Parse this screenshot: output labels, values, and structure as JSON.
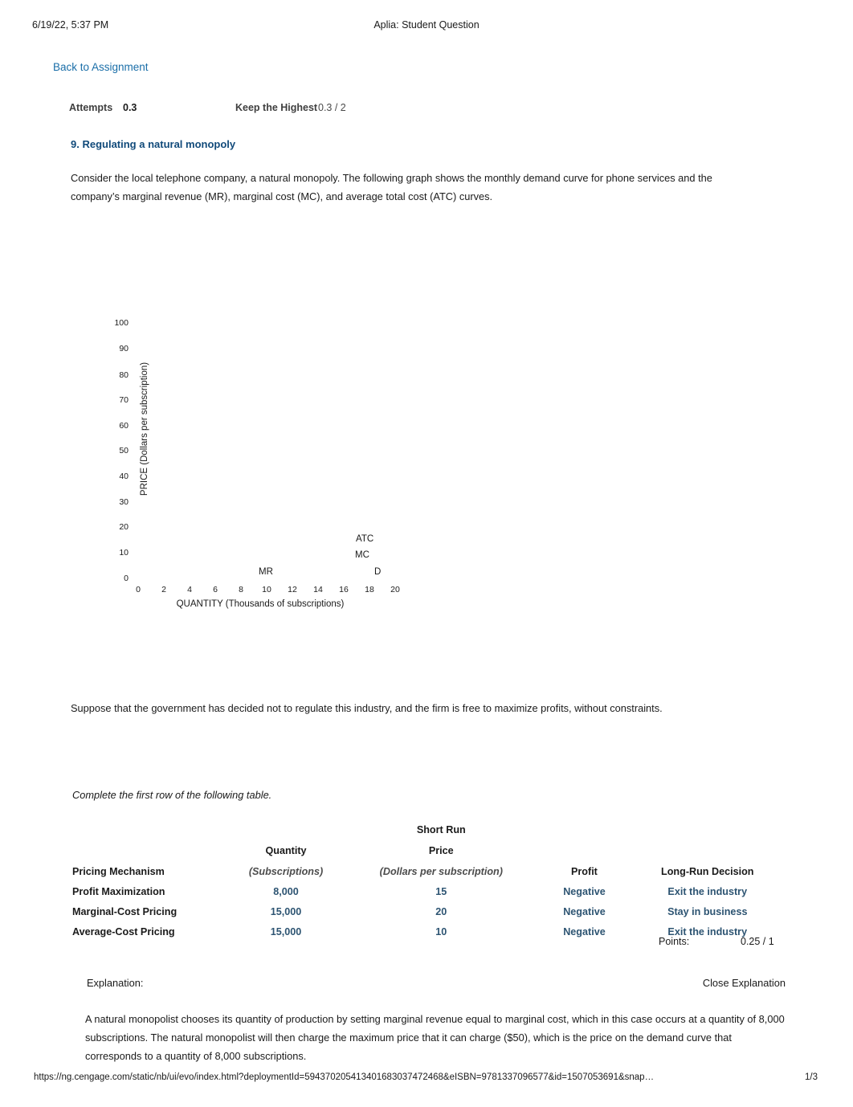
{
  "print_header": {
    "date": "6/19/22, 5:37 PM",
    "title": "Aplia: Student Question"
  },
  "nav": {
    "back_link": "Back to Assignment",
    "link_color": "#1a6ea8"
  },
  "attempts": {
    "label": "Attempts",
    "value": "0.3",
    "keep_label": "Keep the Highest",
    "keep_value": "0.3 / 2"
  },
  "question": {
    "title": "9. Regulating a natural monopoly",
    "title_color": "#114a7a",
    "intro": "Consider the local telephone company, a natural monopoly. The following graph shows the monthly demand curve for phone services and the company’s marginal revenue (MR), marginal cost (MC), and average total cost (ATC) curves.",
    "suppose": "Suppose that the government has decided not to regulate this industry, and the firm is free to maximize profits, without constraints.",
    "instruction": "Complete the first row of the following table."
  },
  "chart_data": {
    "type": "line",
    "title": "",
    "xlabel": "QUANTITY (Thousands of subscriptions)",
    "ylabel": "PRICE (Dollars per subscription)",
    "xlim": [
      0,
      20
    ],
    "ylim": [
      0,
      100
    ],
    "xticks": [
      0,
      2,
      4,
      6,
      8,
      10,
      12,
      14,
      16,
      18,
      20
    ],
    "yticks": [
      0,
      10,
      20,
      30,
      40,
      50,
      60,
      70,
      80,
      90,
      100
    ],
    "grid": false,
    "legend_position": "in-plot-annotations",
    "note": "Curves are not rendered in this printout; only the curve name annotations are visible.",
    "annotations": [
      {
        "text": "ATC",
        "x": 17.4,
        "y": 14.5
      },
      {
        "text": "MC",
        "x": 17.3,
        "y": 11.5
      },
      {
        "text": "MR",
        "x": 9.5,
        "y": 5.0
      },
      {
        "text": "D",
        "x": 18.0,
        "y": 5.0
      }
    ],
    "series": [
      {
        "name": "D",
        "values": []
      },
      {
        "name": "MR",
        "values": []
      },
      {
        "name": "MC",
        "values": []
      },
      {
        "name": "ATC",
        "values": []
      }
    ]
  },
  "table": {
    "group_header": "Short Run",
    "headers": {
      "mechanism": "Pricing Mechanism",
      "quantity": "Quantity",
      "quantity_unit": "(Subscriptions)",
      "price": "Price",
      "price_unit": "(Dollars per subscription)",
      "profit": "Profit",
      "long_run": "Long-Run Decision"
    },
    "value_color": "#2d5472",
    "rows": [
      {
        "mechanism": "Profit Maximization",
        "quantity": "8,000",
        "price": "15",
        "profit": "Negative",
        "long_run": "Exit the industry"
      },
      {
        "mechanism": "Marginal-Cost Pricing",
        "quantity": "15,000",
        "price": "20",
        "profit": "Negative",
        "long_run": "Stay in business"
      },
      {
        "mechanism": "Average-Cost Pricing",
        "quantity": "15,000",
        "price": "10",
        "profit": "Negative",
        "long_run": "Exit the industry"
      }
    ]
  },
  "points": {
    "label": "Points:",
    "value": "0.25 / 1"
  },
  "explanation": {
    "label": "Explanation:",
    "close_label": "Close Explanation",
    "body": "A natural monopolist chooses its quantity of production by setting marginal revenue equal to marginal cost, which in this case occurs at a quantity of 8,000 subscriptions. The natural monopolist will then charge the maximum price that it can charge ($50), which is the price on the demand curve that corresponds to a quantity of 8,000 subscriptions."
  },
  "print_footer": {
    "url": "https://ng.cengage.com/static/nb/ui/evo/index.html?deploymentId=594370205413401683037472468&eISBN=9781337096577&id=1507053691&snap…",
    "page": "1/3"
  }
}
